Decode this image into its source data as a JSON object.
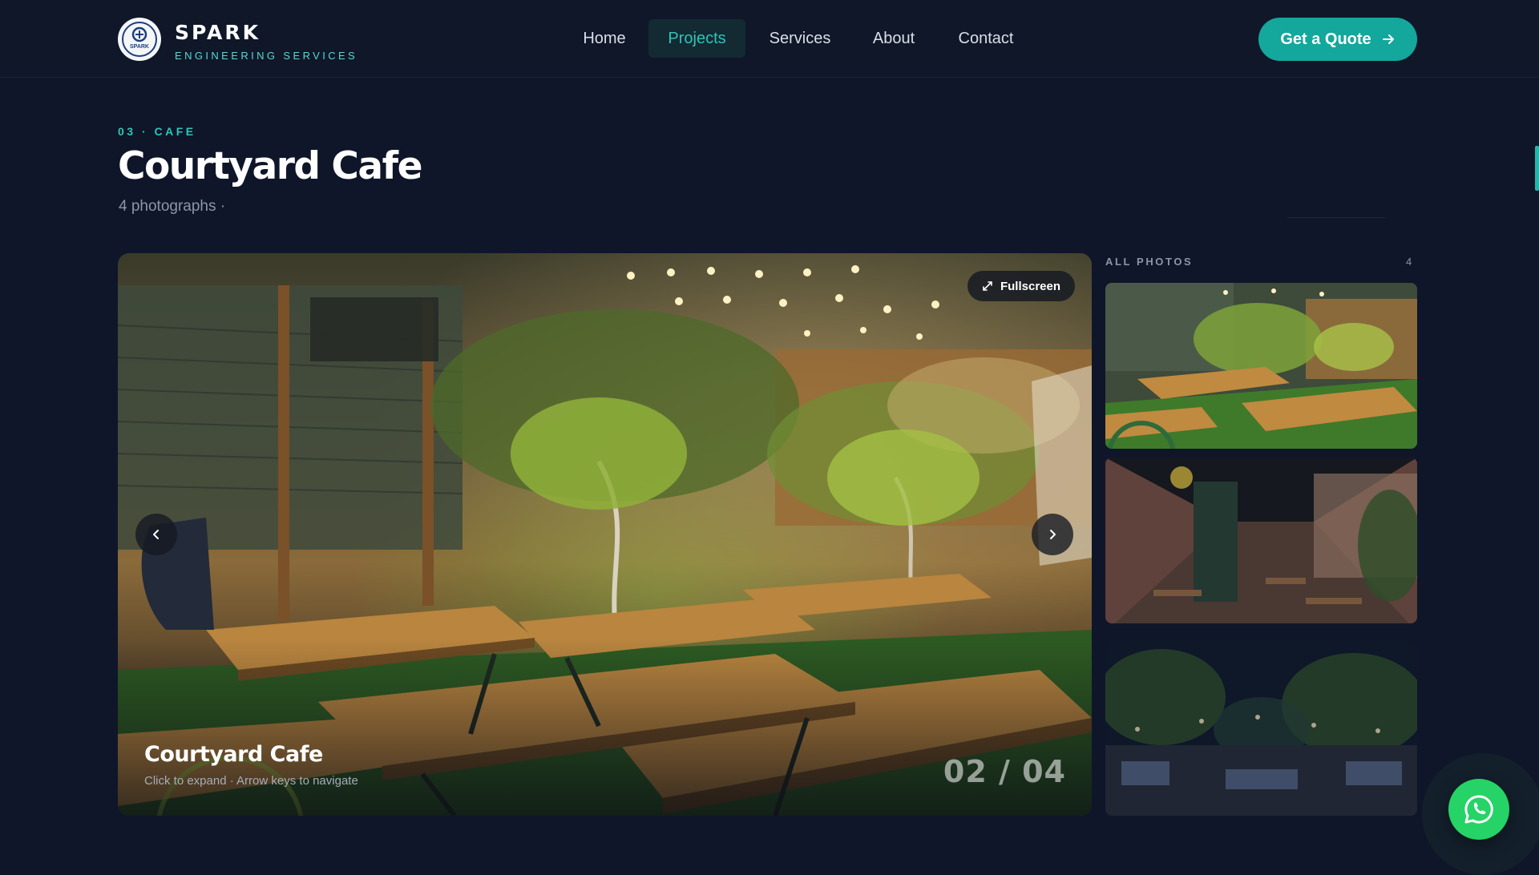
{
  "header": {
    "brand_name": "SPARK",
    "brand_tagline": "ENGINEERING SERVICES",
    "logo_text": "SPARK",
    "nav": [
      {
        "label": "Home",
        "active": false
      },
      {
        "label": "Projects",
        "active": true
      },
      {
        "label": "Services",
        "active": false
      },
      {
        "label": "About",
        "active": false
      },
      {
        "label": "Contact",
        "active": false
      }
    ],
    "cta_label": "Get a Quote",
    "cta_icon": "arrow-right-icon"
  },
  "project": {
    "eyebrow": "03 · CAFE",
    "title": "Courtyard Cafe",
    "photo_count_text": "4 photographs ·"
  },
  "viewer": {
    "fullscreen_label": "Fullscreen",
    "caption_title": "Courtyard Cafe",
    "caption_hint": "Click to expand · Arrow keys to navigate",
    "counter": "02 / 04",
    "prev_icon": "chevron-left-icon",
    "next_icon": "chevron-right-icon"
  },
  "gallery": {
    "heading": "ALL PHOTOS",
    "count": "4",
    "thumbs": [
      "courtyard-seating",
      "toss-cafe-interior",
      "night-courtyard"
    ]
  },
  "colors": {
    "background": "#0f1629",
    "accent": "#2ec4b6",
    "cta": "#14a79c",
    "whatsapp": "#25d366"
  }
}
